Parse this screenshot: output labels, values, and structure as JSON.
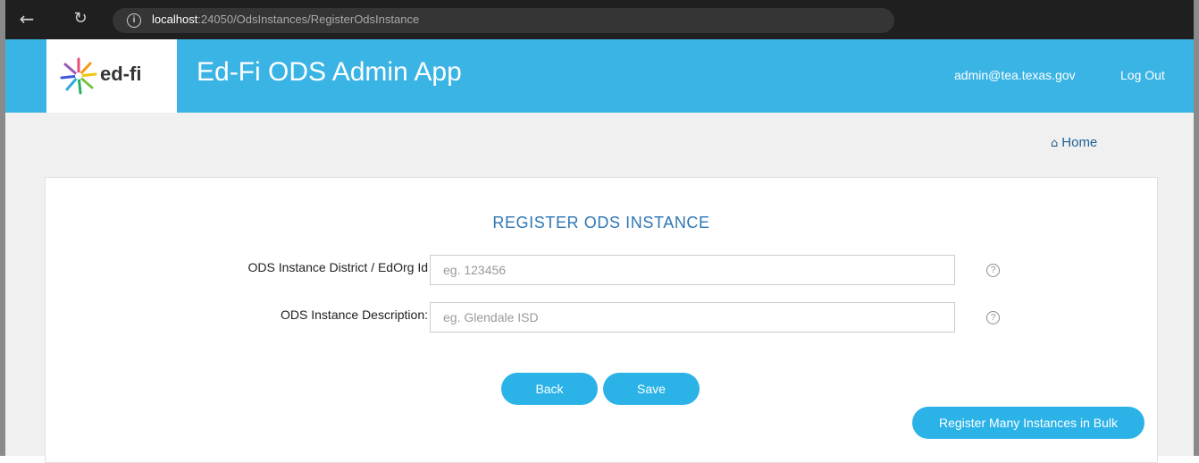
{
  "browser": {
    "url_host": "localhost",
    "url_path": ":24050/OdsInstances/RegisterOdsInstance"
  },
  "header": {
    "logo_text": "ed-fi",
    "title": "Ed-Fi ODS Admin App",
    "user_email": "admin@tea.texas.gov",
    "logout_label": "Log Out"
  },
  "nav": {
    "home_label": "Home"
  },
  "form": {
    "title": "REGISTER ODS INSTANCE",
    "fields": [
      {
        "label": "ODS Instance District / EdOrg Id",
        "placeholder": "eg. 123456",
        "value": ""
      },
      {
        "label": "ODS Instance Description:",
        "placeholder": "eg. Glendale ISD",
        "value": ""
      }
    ],
    "back_label": "Back",
    "save_label": "Save",
    "bulk_label": "Register Many Instances in Bulk"
  },
  "colors": {
    "header_bg": "#3ab4e4",
    "button_bg": "#2bb3e8",
    "title_color": "#2e77b5"
  },
  "icons": [
    "back-arrow-icon",
    "reload-icon",
    "info-icon",
    "home-icon",
    "help-icon"
  ]
}
